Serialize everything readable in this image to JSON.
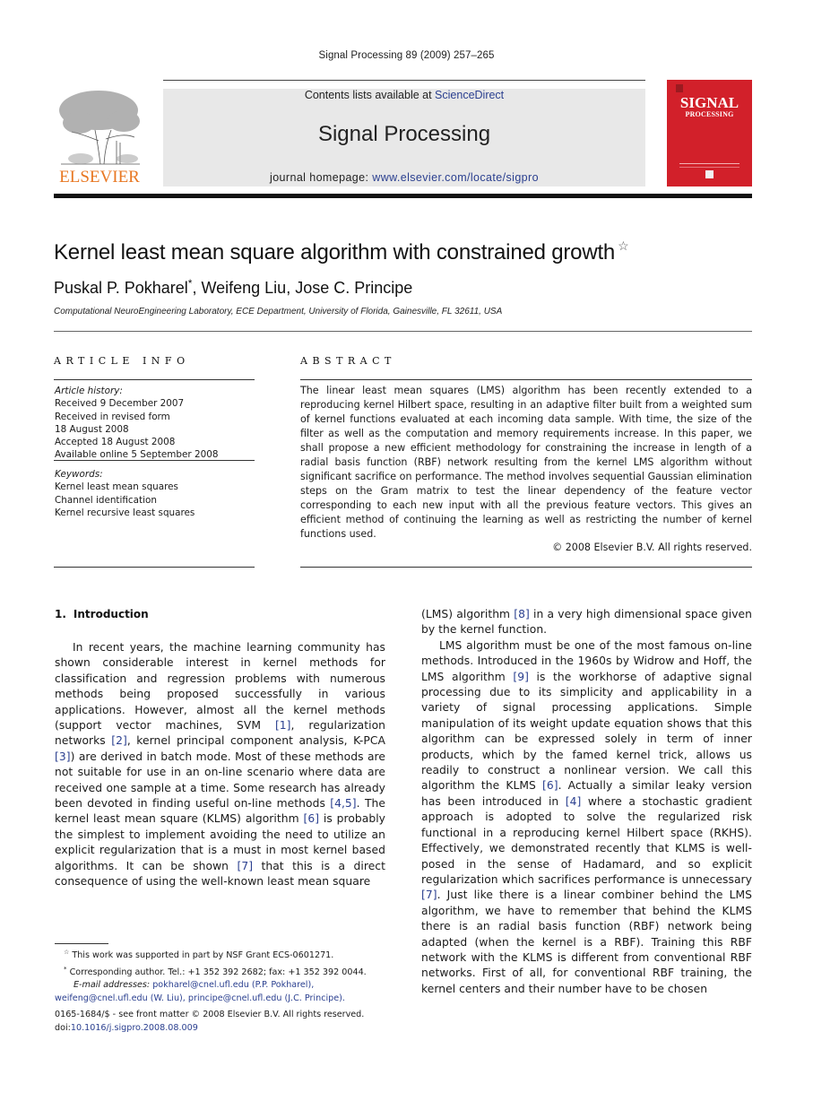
{
  "header": {
    "journal_reference": "Signal Processing 89 (2009) 257–265",
    "contents_prefix": "Contents lists available at ",
    "contents_link": "ScienceDirect",
    "journal_title": "Signal Processing",
    "homepage_prefix": "journal homepage: ",
    "homepage_link": "www.elsevier.com/locate/sigpro",
    "publisher_logo_text": "ELSEVIER",
    "cover_title": "SIGNAL",
    "cover_subtitle": "PROCESSING"
  },
  "colors": {
    "link": "#2a3f8f",
    "elsevier_orange": "#e87722",
    "cover_red": "#d2202a",
    "masthead_gray": "#e8e8e8"
  },
  "article": {
    "title": "Kernel least mean square algorithm with constrained growth",
    "title_note_mark": "☆",
    "authors": [
      {
        "name": "Puskal P. Pokharel",
        "mark": "*"
      },
      {
        "name": "Weifeng Liu",
        "mark": ""
      },
      {
        "name": "Jose C. Principe",
        "mark": ""
      }
    ],
    "affiliation": "Computational NeuroEngineering Laboratory, ECE Department, University of Florida, Gainesville, FL 32611, USA"
  },
  "article_info": {
    "heading": "ARTICLE INFO",
    "history_label": "Article history:",
    "history": [
      "Received 9 December 2007",
      "Received in revised form",
      "18 August 2008",
      "Accepted 18 August 2008",
      "Available online 5 September 2008"
    ],
    "keywords_label": "Keywords:",
    "keywords": [
      "Kernel least mean squares",
      "Channel identification",
      "Kernel recursive least squares"
    ]
  },
  "abstract": {
    "heading": "ABSTRACT",
    "text": "The linear least mean squares (LMS) algorithm has been recently extended to a reproducing kernel Hilbert space, resulting in an adaptive filter built from a weighted sum of kernel functions evaluated at each incoming data sample. With time, the size of the filter as well as the computation and memory requirements increase. In this paper, we shall propose a new efficient methodology for constraining the increase in length of a radial basis function (RBF) network resulting from the kernel LMS algorithm without significant sacrifice on performance. The method involves sequential Gaussian elimination steps on the Gram matrix to test the linear dependency of the feature vector corresponding to each new input with all the previous feature vectors. This gives an efficient method of continuing the learning as well as restricting the number of kernel functions used.",
    "copyright": "© 2008 Elsevier B.V. All rights reserved."
  },
  "introduction": {
    "number": "1.",
    "heading": "Introduction",
    "left_col": [
      {
        "t": "In recent years, the machine learning community has shown considerable interest in kernel methods for classification and regression problems with numerous methods being proposed successfully in various applications. However, almost all the kernel methods (support vector machines, SVM "
      },
      {
        "ref": "[1]"
      },
      {
        "t": ", regularization networks "
      },
      {
        "ref": "[2]"
      },
      {
        "t": ", kernel principal component analysis, K-PCA "
      },
      {
        "ref": "[3]"
      },
      {
        "t": ") are derived in batch mode. Most of these methods are not suitable for use in an on-line scenario where data are received one sample at a time. Some research has already been devoted in finding useful on-line methods "
      },
      {
        "ref": "[4,5]"
      },
      {
        "t": ". The kernel least mean square (KLMS) algorithm "
      },
      {
        "ref": "[6]"
      },
      {
        "t": " is probably the simplest to implement avoiding the need to utilize an explicit regularization that is a must in most kernel based algorithms. It can be shown "
      },
      {
        "ref": "[7]"
      },
      {
        "t": " that this is a direct consequence of using the well-known least mean square"
      }
    ],
    "right_col_p1": [
      {
        "t": "(LMS) algorithm "
      },
      {
        "ref": "[8]"
      },
      {
        "t": " in a very high dimensional space given by the kernel function."
      }
    ],
    "right_col_p2": [
      {
        "t": "LMS algorithm must be one of the most famous on-line methods. Introduced in the 1960s by Widrow and Hoff, the LMS algorithm "
      },
      {
        "ref": "[9]"
      },
      {
        "t": " is the workhorse of adaptive signal processing due to its simplicity and applicability in a variety of signal processing applications. Simple manipulation of its weight update equation shows that this algorithm can be expressed solely in term of inner products, which by the famed kernel trick, allows us readily to construct a nonlinear version. We call this algorithm the KLMS "
      },
      {
        "ref": "[6]"
      },
      {
        "t": ". Actually a similar leaky version has been introduced in "
      },
      {
        "ref": "[4]"
      },
      {
        "t": " where a stochastic gradient approach is adopted to solve the regularized risk functional in a reproducing kernel Hilbert space (RKHS). Effectively, we demonstrated recently that KLMS is well-posed in the sense of Hadamard, and so explicit regularization which sacrifices performance is unnecessary "
      },
      {
        "ref": "[7]"
      },
      {
        "t": ". Just like there is a linear combiner behind the LMS algorithm, we have to remember that behind the KLMS there is an radial basis function (RBF) network being adapted (when the kernel is a RBF). Training this RBF network with the KLMS is different from conventional RBF networks. First of all, for conventional RBF training, the kernel centers and their number have to be chosen"
      }
    ]
  },
  "footnotes": {
    "star_mark": "☆",
    "funding": "This work was supported in part by NSF Grant ECS-0601271.",
    "corr_mark": "*",
    "corresponding": "Corresponding author. Tel.: +1 352 392 2682; fax: +1 352 392 0044.",
    "email_label": "E-mail addresses: ",
    "emails": [
      {
        "address": "pokharel@cnel.ufl.edu",
        "owner": " (P.P. Pokharel),"
      },
      {
        "address": "weifeng@cnel.ufl.edu",
        "owner": " (W. Liu), "
      },
      {
        "address": "principe@cnel.ufl.edu",
        "owner": " (J.C. Principe)."
      }
    ],
    "front_matter": "0165-1684/$ - see front matter © 2008 Elsevier B.V. All rights reserved.",
    "doi_prefix": "doi:",
    "doi_link": "10.1016/j.sigpro.2008.08.009"
  }
}
